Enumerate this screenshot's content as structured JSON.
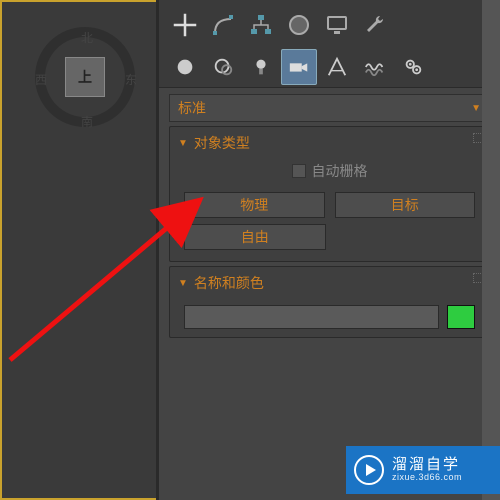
{
  "viewcube": {
    "face": "上",
    "north": "北",
    "south": "南",
    "east": "东",
    "west": "西"
  },
  "dropdown": {
    "selected": "标准",
    "chevron": "▼"
  },
  "rollout_objtype": {
    "title": "对象类型",
    "tri": "▼",
    "autogrid": "自动栅格",
    "buttons": {
      "physical": "物理",
      "target": "目标",
      "free": "自由"
    }
  },
  "rollout_namecolor": {
    "title": "名称和颜色",
    "tri": "▼",
    "color": "#2ecc40"
  },
  "watermark": {
    "title": "溜溜自学",
    "url": "zixue.3d66.com"
  }
}
